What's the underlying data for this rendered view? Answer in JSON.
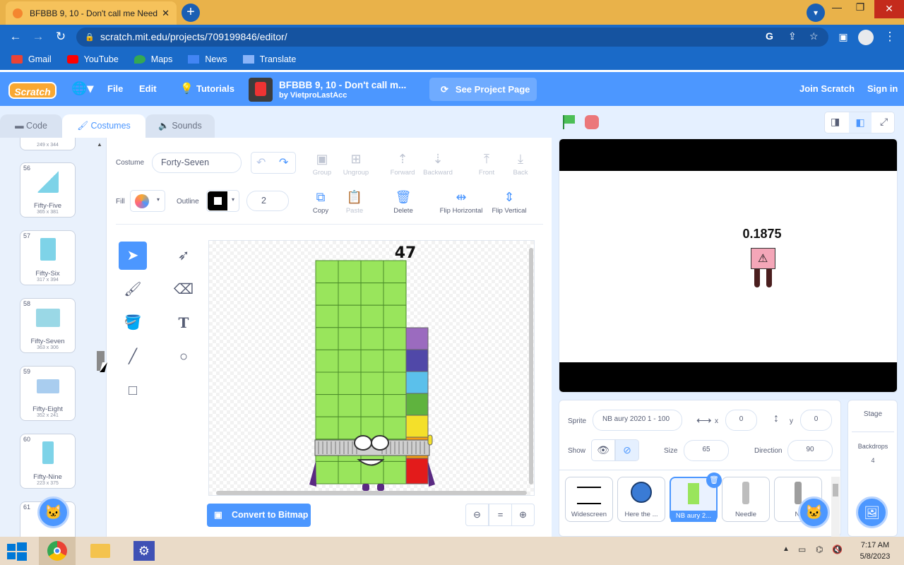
{
  "browser": {
    "tab_title": "BFBBB 9, 10 - Don't call me Need",
    "url": "scratch.mit.edu/projects/709199846/editor/",
    "bookmarks": [
      "Gmail",
      "YouTube",
      "Maps",
      "News",
      "Translate"
    ]
  },
  "menu": {
    "logo": "Scratch",
    "file": "File",
    "edit": "Edit",
    "tutorials": "Tutorials",
    "project_title": "BFBBB 9, 10 - Don't call m...",
    "author": "by VietproLastAcc",
    "see_project": "See Project Page",
    "join": "Join Scratch",
    "signin": "Sign in"
  },
  "tabs": {
    "code": "Code",
    "costumes": "Costumes",
    "sounds": "Sounds"
  },
  "costume_list": {
    "top_partial_size": "249 x 344",
    "items": [
      {
        "num": "56",
        "name": "Fifty-Five",
        "size": "365 x 381"
      },
      {
        "num": "57",
        "name": "Fifty-Six",
        "size": "317 x 394"
      },
      {
        "num": "58",
        "name": "Fifty-Seven",
        "size": "363 x 306"
      },
      {
        "num": "59",
        "name": "Fifty-Eight",
        "size": "352 x 241"
      },
      {
        "num": "60",
        "name": "Fifty-Nine",
        "size": "223 x 375"
      }
    ],
    "bottom_partial_num": "61"
  },
  "paint": {
    "costume_label": "Costume",
    "costume_name": "Forty-Seven",
    "fill_label": "Fill",
    "outline_label": "Outline",
    "outline_width": "2",
    "group": "Group",
    "ungroup": "Ungroup",
    "forward": "Forward",
    "backward": "Backward",
    "front": "Front",
    "back": "Back",
    "copy": "Copy",
    "paste": "Paste",
    "delete": "Delete",
    "flip_h": "Flip Horizontal",
    "flip_v": "Flip Vertical",
    "convert": "Convert to Bitmap",
    "canvas_number": "47"
  },
  "stage": {
    "display_value": "0.1875"
  },
  "sprite_info": {
    "sprite_label": "Sprite",
    "sprite_name": "NB aury 2020 1 - 100",
    "x_label": "x",
    "x": "0",
    "y_label": "y",
    "y": "0",
    "show_label": "Show",
    "size_label": "Size",
    "size": "65",
    "direction_label": "Direction",
    "direction": "90"
  },
  "sprites": [
    "Widescreen",
    "Here the ...",
    "NB aury 2...",
    "Needle",
    "Ni"
  ],
  "stage_pane": {
    "title": "Stage",
    "backdrops_label": "Backdrops",
    "backdrops_count": "4"
  },
  "taskbar": {
    "time": "7:17 AM",
    "date": "5/8/2023"
  },
  "colors": {
    "scratch_blue": "#4c97ff",
    "numberblock_green": "#99e55c"
  }
}
